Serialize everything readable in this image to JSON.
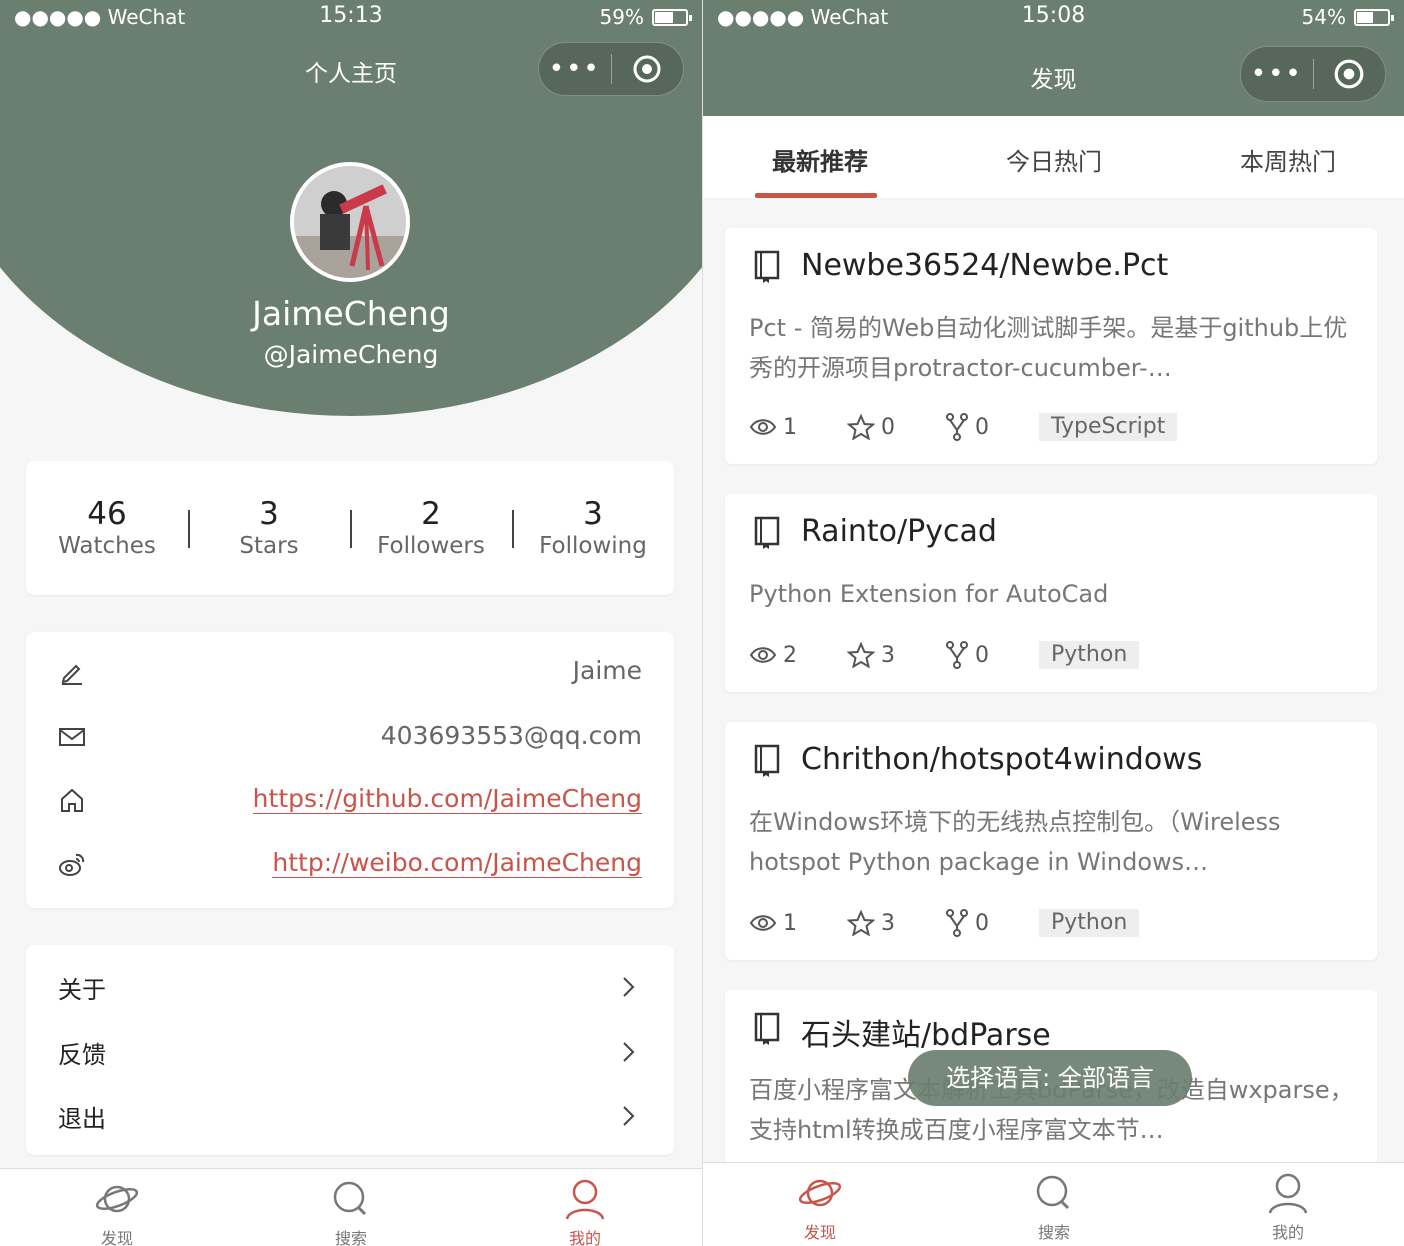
{
  "left": {
    "status": {
      "carrier": "●●●●● WeChat",
      "time": "15:13",
      "battery": "59%",
      "battery_level": 0.59
    },
    "nav_title": "个人主页",
    "capsule_dots": "•••",
    "profile": {
      "username": "JaimeCheng",
      "handle": "@JaimeCheng"
    },
    "stats": [
      {
        "num": "46",
        "label": "Watches"
      },
      {
        "num": "3",
        "label": "Stars"
      },
      {
        "num": "2",
        "label": "Followers"
      },
      {
        "num": "3",
        "label": "Following"
      }
    ],
    "info": {
      "name": "Jaime",
      "email": "403693553@qq.com",
      "blog": "https://github.com/JaimeCheng",
      "weibo": "http://weibo.com/JaimeCheng"
    },
    "menu": [
      "关于",
      "反馈",
      "退出"
    ],
    "tabs": [
      "发现",
      "搜索",
      "我的"
    ]
  },
  "right": {
    "status": {
      "carrier": "●●●●● WeChat",
      "time": "15:08",
      "battery": "54%",
      "battery_level": 0.54
    },
    "nav_title": "发现",
    "capsule_dots": "•••",
    "top_tabs": [
      "最新推荐",
      "今日热门",
      "本周热门"
    ],
    "repos": [
      {
        "name": "Newbe36524/Newbe.Pct",
        "desc": "Pct - 简易的Web自动化测试脚手架。是基于github上优秀的开源项目protractor-cucumber-…",
        "watch": "1",
        "star": "0",
        "fork": "0",
        "lang": "TypeScript"
      },
      {
        "name": "Rainto/Pycad",
        "desc": "Python Extension for AutoCad",
        "watch": "2",
        "star": "3",
        "fork": "0",
        "lang": "Python"
      },
      {
        "name": "Chrithon/hotspot4windows",
        "desc": "在Windows环境下的无线热点控制包。（Wireless hotspot Python package in Windows…",
        "watch": "1",
        "star": "3",
        "fork": "0",
        "lang": "Python"
      },
      {
        "name": "石头建站/bdParse",
        "desc": "百度小程序富文本解析工具bdParse，改造自wxparse，支持html转换成百度小程序富文本节…"
      }
    ],
    "toast": "选择语言: 全部语言",
    "tabs": [
      "发现",
      "搜索",
      "我的"
    ]
  },
  "colors": {
    "theme": "#6b7f70",
    "accent": "#c9544a"
  }
}
